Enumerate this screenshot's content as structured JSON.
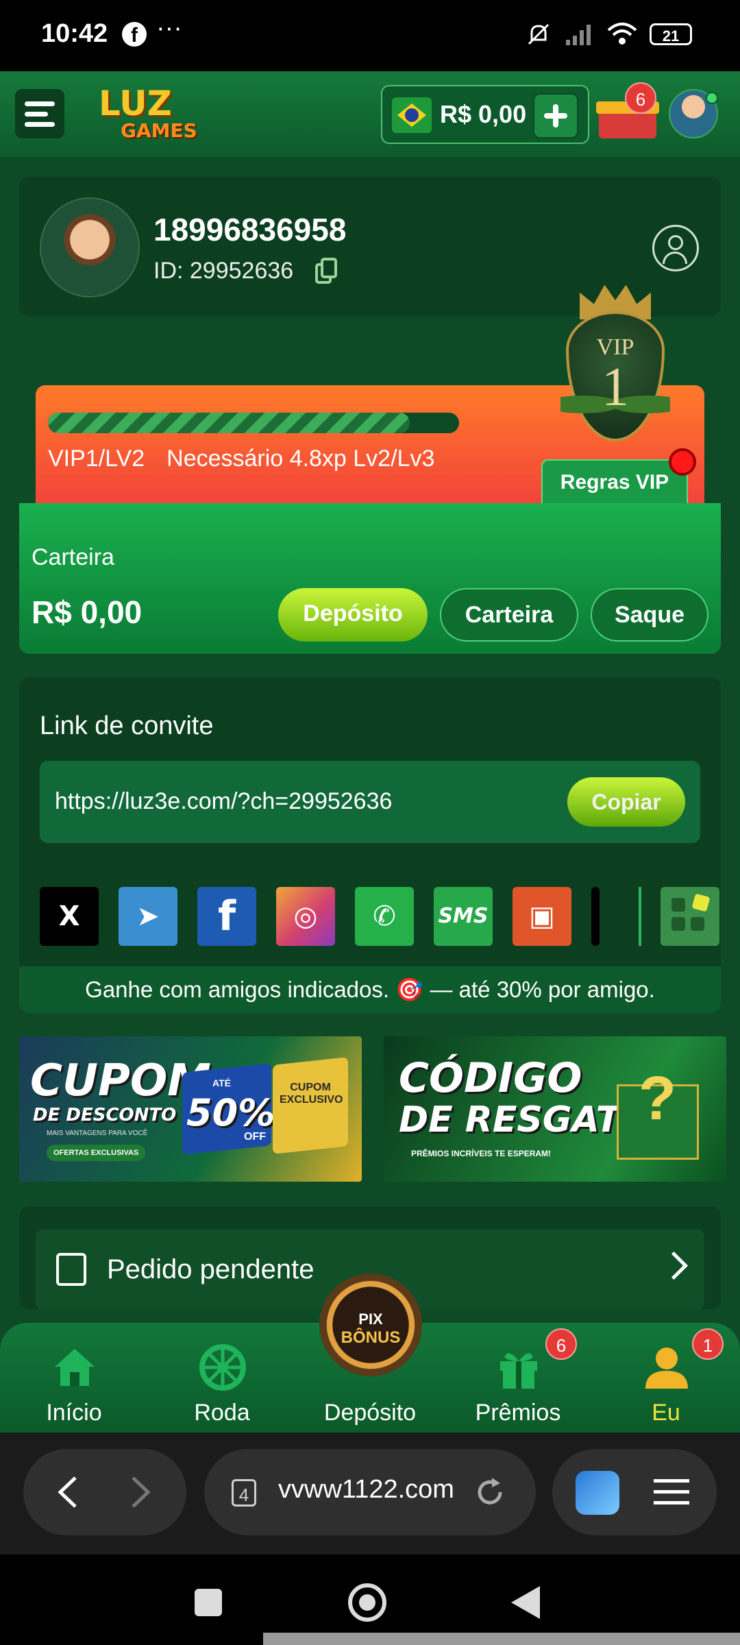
{
  "status_bar": {
    "time": "10:42",
    "battery": "21",
    "icons": [
      "facebook-icon",
      "more-dots-icon",
      "mute-icon",
      "signal-icon",
      "wifi-icon",
      "battery-icon"
    ]
  },
  "header": {
    "logo_line1": "LUZ",
    "logo_line2": "GAMES",
    "balance": "R$ 0,00",
    "gift_badge": "6"
  },
  "profile": {
    "name": "18996836958",
    "id_text": "ID: 29952636"
  },
  "vip": {
    "progress": 0.88,
    "level": "VIP1/LV2",
    "requirement": "Necessário 4.8xp Lv2/Lv3",
    "badge_title": "VIP",
    "badge_number": "1",
    "rules_button": "Regras VIP"
  },
  "wallet": {
    "label": "Carteira",
    "amount": "R$ 0,00",
    "buttons": [
      "Depósito",
      "Carteira",
      "Saque"
    ]
  },
  "invite": {
    "title": "Link de convite",
    "link": "https://luz3e.com/?ch=29952636",
    "copy_button": "Copiar",
    "share": [
      {
        "name": "x",
        "glyph": "X",
        "bg": "#000000"
      },
      {
        "name": "telegram",
        "glyph": "➤",
        "bg": "#3b8fd1"
      },
      {
        "name": "facebook",
        "glyph": "f",
        "bg": "#1e5bb3"
      },
      {
        "name": "instagram",
        "glyph": "◎",
        "bg": "#d4416e"
      },
      {
        "name": "whatsapp",
        "glyph": "✆",
        "bg": "#25b04a"
      },
      {
        "name": "sms",
        "glyph": "SMS",
        "bg": "#27a84a"
      },
      {
        "name": "kwai",
        "glyph": "▣",
        "bg": "#e0552a"
      }
    ],
    "promo": "Ganhe com amigos indicados. 🎯 — até 30% por amigo."
  },
  "banners": {
    "coupon_line1": "CUPOM",
    "coupon_line2": "DE DESCONTO",
    "coupon_line3": "MAIS VANTAGENS PARA VOCÊ",
    "coupon_line4": "OFERTAS EXCLUSIVAS",
    "coupon_upto": "ATÉ",
    "coupon_percent": "50%",
    "coupon_off": "OFF",
    "coupon_ticket": "CUPOM EXCLUSIVO",
    "code_line1": "CÓDIGO",
    "code_line2": "DE RESGATE",
    "code_line3": "PRÊMIOS INCRÍVEIS TE ESPERAM!"
  },
  "pending": {
    "label": "Pedido pendente"
  },
  "nav": {
    "items": [
      {
        "label": "Início",
        "icon": "home-icon"
      },
      {
        "label": "Roda",
        "icon": "wheel-icon"
      },
      {
        "label": "Depósito",
        "icon": "pix-bonus-icon"
      },
      {
        "label": "Prêmios",
        "icon": "gift-icon",
        "badge": "6"
      },
      {
        "label": "Eu",
        "icon": "user-icon",
        "badge": "1"
      }
    ],
    "pix_line1": "PIX",
    "pix_line2": "BÔNUS",
    "active_color": "#f2e33b"
  },
  "browser": {
    "url": "vvww1122.com",
    "tab_count": "4"
  },
  "colors": {
    "background": "#0f4a26",
    "accent_green": "#1ab04f",
    "lime": "#c9f53b",
    "vip_orange": "#ff7a2a"
  }
}
